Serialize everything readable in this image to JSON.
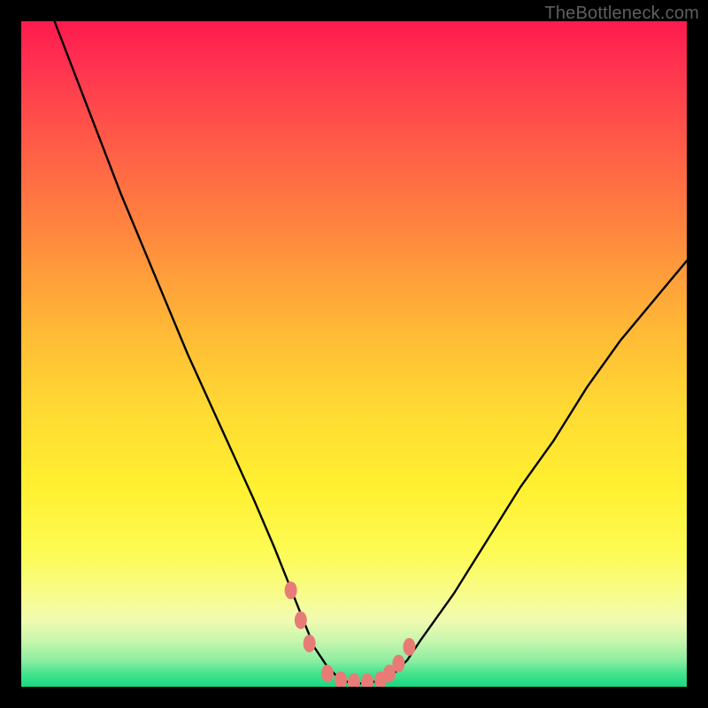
{
  "watermark": {
    "text": "TheBottleneck.com"
  },
  "chart_data": {
    "type": "line",
    "title": "",
    "xlabel": "",
    "ylabel": "",
    "xlim": [
      0,
      100
    ],
    "ylim": [
      0,
      100
    ],
    "grid": false,
    "legend": false,
    "annotations": [],
    "series": [
      {
        "name": "curve",
        "x": [
          5,
          10,
          15,
          20,
          25,
          30,
          35,
          38,
          40,
          42,
          44,
          46,
          48,
          50,
          52,
          54,
          56,
          58,
          60,
          65,
          70,
          75,
          80,
          85,
          90,
          95,
          100
        ],
        "y": [
          100,
          87,
          74,
          62,
          50,
          39,
          28,
          21,
          16,
          11,
          6,
          3,
          1,
          0.5,
          0.5,
          1,
          2,
          4,
          7,
          14,
          22,
          30,
          37,
          45,
          52,
          58,
          64
        ]
      },
      {
        "name": "markers",
        "x": [
          40.5,
          42.0,
          43.3,
          46.0,
          48.0,
          50.0,
          52.0,
          54.0,
          55.3,
          56.7,
          58.3
        ],
        "y": [
          14.5,
          10.0,
          6.5,
          2.0,
          1.0,
          0.7,
          0.7,
          1.0,
          2.0,
          3.5,
          6.0
        ]
      }
    ],
    "background_gradient_stops": [
      {
        "pos": 0.0,
        "color": "#ff1a4d"
      },
      {
        "pos": 0.5,
        "color": "#ffc834"
      },
      {
        "pos": 0.8,
        "color": "#fdfb55"
      },
      {
        "pos": 1.0,
        "color": "#17d97f"
      }
    ]
  }
}
